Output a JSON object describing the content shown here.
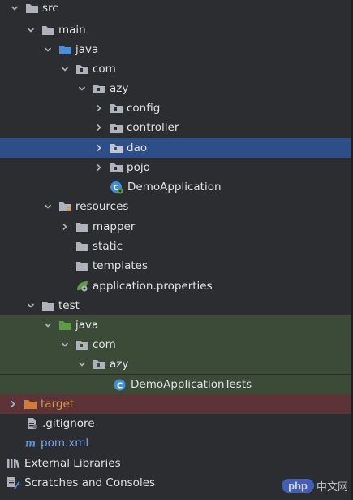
{
  "tree": {
    "src": "src",
    "main": "main",
    "java_main": "java",
    "com_main": "com",
    "azy_main": "azy",
    "config": "config",
    "controller": "controller",
    "dao": "dao",
    "pojo": "pojo",
    "demo_application": "DemoApplication",
    "resources": "resources",
    "mapper": "mapper",
    "static": "static",
    "templates": "templates",
    "application_properties": "application.properties",
    "test": "test",
    "java_test": "java",
    "com_test": "com",
    "azy_test": "azy",
    "demo_application_tests": "DemoApplicationTests",
    "target": "target",
    "gitignore": ".gitignore",
    "pom": "pom.xml",
    "external_libraries": "External Libraries",
    "scratches": "Scratches and Consoles"
  },
  "watermark": {
    "badge": "php",
    "site": "中文网"
  },
  "colors": {
    "background": "#2b2d30",
    "selection": "#2e4e88",
    "test_source_bg": "#3c4a38",
    "excluded_bg": "#5c3438",
    "folder": "#aeb3bb",
    "source_folder": "#4c8fd6",
    "test_folder": "#5d9b47",
    "excluded_folder": "#d27b3a"
  }
}
